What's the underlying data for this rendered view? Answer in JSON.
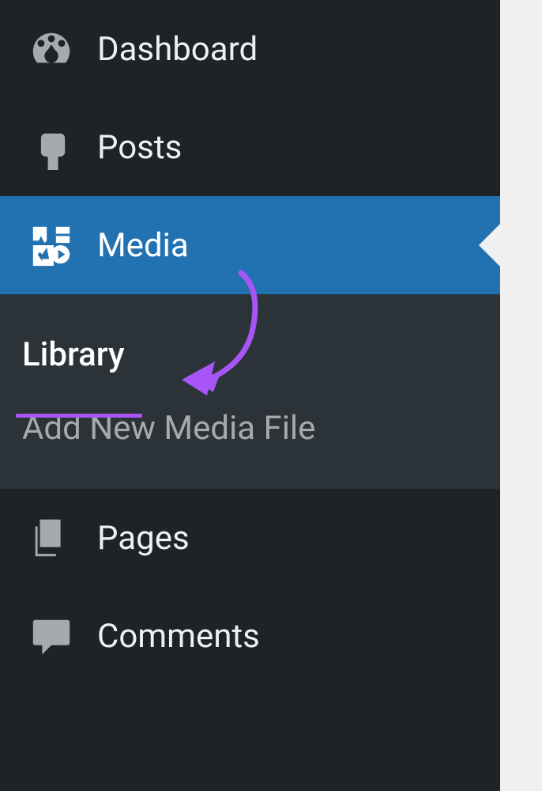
{
  "sidebar": {
    "items": [
      {
        "label": "Dashboard",
        "icon": "dashboard"
      },
      {
        "label": "Posts",
        "icon": "pin"
      },
      {
        "label": "Media",
        "icon": "media",
        "active": true
      },
      {
        "label": "Pages",
        "icon": "pages"
      },
      {
        "label": "Comments",
        "icon": "comments"
      }
    ],
    "submenu": [
      {
        "label": "Library",
        "current": true
      },
      {
        "label": "Add New Media File",
        "current": false
      }
    ]
  },
  "annotation": {
    "color": "#a855f7"
  }
}
